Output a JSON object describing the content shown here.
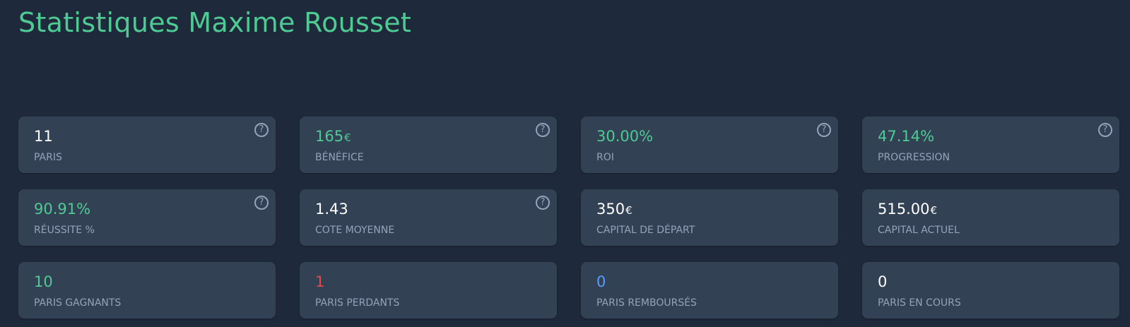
{
  "header": {
    "title": "Statistiques Maxime Rousset"
  },
  "help_symbol": "?",
  "stats": [
    {
      "value": "11",
      "currency": "",
      "label": "Paris",
      "color": "white",
      "help": true
    },
    {
      "value": "165",
      "currency": "€",
      "label": "Bénéfice",
      "color": "green",
      "help": true
    },
    {
      "value": "30.00%",
      "currency": "",
      "label": "ROI",
      "color": "green",
      "help": true
    },
    {
      "value": "47.14%",
      "currency": "",
      "label": "Progression",
      "color": "green",
      "help": true
    },
    {
      "value": "90.91%",
      "currency": "",
      "label": "Réussite %",
      "color": "green",
      "help": true
    },
    {
      "value": "1.43",
      "currency": "",
      "label": "Cote moyenne",
      "color": "white",
      "help": true
    },
    {
      "value": "350",
      "currency": "€",
      "label": "Capital de départ",
      "color": "white",
      "help": false
    },
    {
      "value": "515.00",
      "currency": "€",
      "label": "Capital actuel",
      "color": "white",
      "help": false
    },
    {
      "value": "10",
      "currency": "",
      "label": "Paris gagnants",
      "color": "green",
      "help": false
    },
    {
      "value": "1",
      "currency": "",
      "label": "Paris perdants",
      "color": "red",
      "help": false
    },
    {
      "value": "0",
      "currency": "",
      "label": "Paris remboursés",
      "color": "blue",
      "help": false
    },
    {
      "value": "0",
      "currency": "",
      "label": "Paris en cours",
      "color": "white",
      "help": false
    }
  ],
  "colors": {
    "background": "#1e293b",
    "card": "#334155",
    "accent_green": "#4ecb93",
    "red": "#e5474b",
    "blue": "#5b9cf6",
    "label_gray": "#94a3b8"
  }
}
